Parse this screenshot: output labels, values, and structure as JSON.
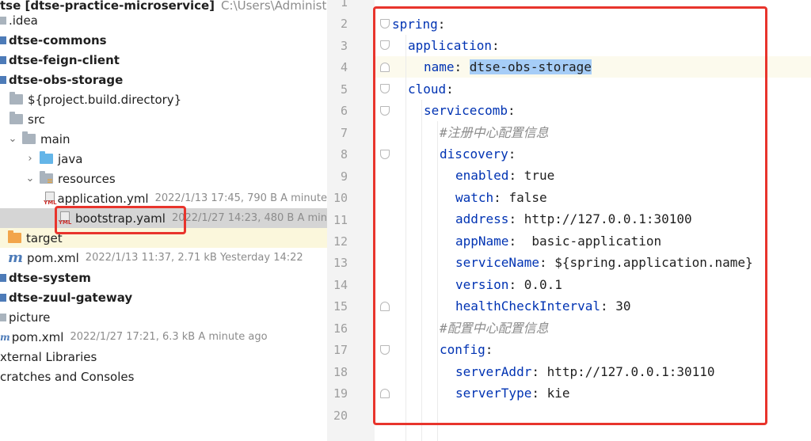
{
  "tree": {
    "rows": [
      {
        "label": "tse [dtse-practice-microservice]",
        "path": "C:\\Users\\Administrator"
      },
      {
        "label": ".idea"
      },
      {
        "label": "dtse-commons"
      },
      {
        "label": "dtse-feign-client"
      },
      {
        "label": "dtse-obs-storage"
      },
      {
        "label": "${project.build.directory}"
      },
      {
        "label": "src"
      },
      {
        "label": "main"
      },
      {
        "label": "java"
      },
      {
        "label": "resources"
      },
      {
        "label": "application.yml",
        "meta": "2022/1/13 17:45, 790 B A minute"
      },
      {
        "label": "bootstrap.yaml",
        "meta": "2022/1/27 14:23, 480 B A min"
      },
      {
        "label": "target"
      },
      {
        "label": "pom.xml",
        "meta": "2022/1/13 11:37, 2.71 kB Yesterday 14:22"
      },
      {
        "label": "dtse-system"
      },
      {
        "label": "dtse-zuul-gateway"
      },
      {
        "label": "picture"
      },
      {
        "label": "pom.xml",
        "meta": "2022/1/27 17:21, 6.3 kB A minute ago"
      },
      {
        "label": "xternal Libraries"
      },
      {
        "label": "cratches and Consoles"
      }
    ]
  },
  "editor": {
    "line_numbers": [
      "1",
      "2",
      "3",
      "4",
      "5",
      "6",
      "7",
      "8",
      "9",
      "10",
      "11",
      "12",
      "13",
      "14",
      "15",
      "16",
      "17",
      "18",
      "19",
      "20"
    ],
    "lines": {
      "l2": {
        "key": "spring",
        "sep": ":"
      },
      "l3": {
        "key": "application",
        "sep": ":"
      },
      "l4": {
        "key": "name",
        "sep": ": ",
        "value": "dtse-obs-storage"
      },
      "l5": {
        "key": "cloud",
        "sep": ":"
      },
      "l6": {
        "key": "servicecomb",
        "sep": ":"
      },
      "l7": {
        "comment": "#注册中心配置信息"
      },
      "l8": {
        "key": "discovery",
        "sep": ":"
      },
      "l9": {
        "key": "enabled",
        "sep": ": ",
        "value": "true"
      },
      "l10": {
        "key": "watch",
        "sep": ": ",
        "value": "false"
      },
      "l11": {
        "key": "address",
        "sep": ": ",
        "value": "http://127.0.0.1:30100"
      },
      "l12": {
        "key": "appName",
        "sep": ":  ",
        "value": "basic-application"
      },
      "l13": {
        "key": "serviceName",
        "sep": ": ",
        "value": "${spring.application.name}"
      },
      "l14": {
        "key": "version",
        "sep": ": ",
        "value": "0.0.1"
      },
      "l15": {
        "key": "healthCheckInterval",
        "sep": ": ",
        "value": "30"
      },
      "l16": {
        "comment": "#配置中心配置信息"
      },
      "l17": {
        "key": "config",
        "sep": ":"
      },
      "l18": {
        "key": "serverAddr",
        "sep": ": ",
        "value": "http://127.0.0.1:30110"
      },
      "l19": {
        "key": "serverType",
        "sep": ": ",
        "value": "kie"
      }
    }
  },
  "colors": {
    "annotation": "#e8342c",
    "yaml_key": "#0033b3",
    "selection": "#a6cdf7"
  }
}
